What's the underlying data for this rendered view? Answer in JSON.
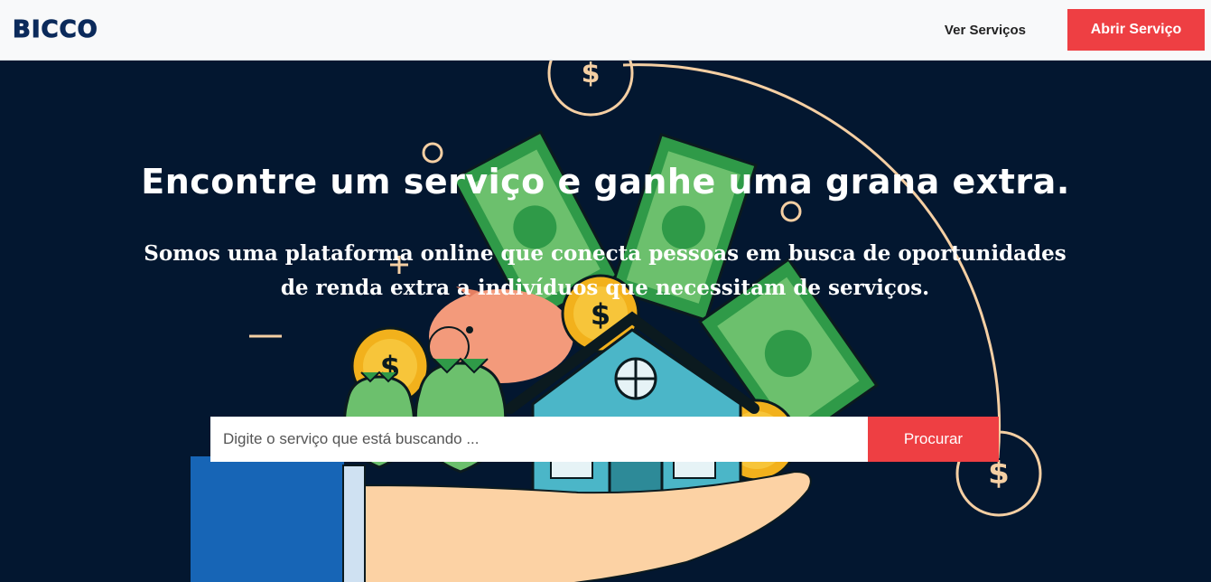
{
  "navbar": {
    "logo": "BICCO",
    "link_label": "Ver Serviços",
    "button_label": "Abrir Serviço"
  },
  "hero": {
    "headline": "Encontre um serviço e ganhe uma grana extra.",
    "subtext": "Somos uma plataforma online que conecta pessoas em busca de oportunidades de renda extra a indivíduos que necessitam de serviços.",
    "search": {
      "placeholder": "Digite o serviço que está buscando ...",
      "value": "",
      "button_label": "Procurar"
    },
    "illustration_glyph": "$"
  },
  "colors": {
    "background": "#031730",
    "accent": "#ee3f43",
    "brand": "#0b2a5b",
    "navbar_bg": "#f8f9fa"
  },
  "icons": [
    "dollar-sign-icon",
    "piggy-bank-icon",
    "house-icon",
    "money-bag-icon",
    "banknote-icon",
    "coin-icon",
    "hand-icon"
  ]
}
